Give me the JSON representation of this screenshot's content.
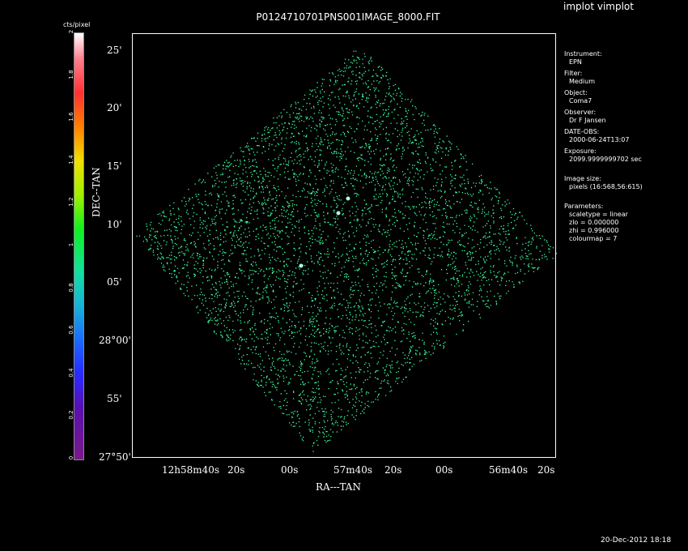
{
  "app_title": "implot vimplot",
  "plot_title": "P0124710701PNS001IMAGE_8000.FIT",
  "colorbar": {
    "label": "cts/pixel",
    "ticks": [
      "0",
      "0.2",
      "0.4",
      "0.6",
      "0.8",
      "1",
      "1.2",
      "1.4",
      "1.6",
      "1.8",
      "2"
    ]
  },
  "axes": {
    "xlabel": "RA---TAN",
    "ylabel": "DEC--TAN",
    "yticks": [
      "25'",
      "20'",
      "15'",
      "10'",
      "05'",
      "28°00'",
      "55'",
      "27°50'"
    ],
    "xticks": [
      "12h58m40s",
      "20s",
      "00s",
      "57m40s",
      "20s",
      "00s",
      "56m40s",
      "20s"
    ]
  },
  "info": {
    "instrument_label": "Instrument:",
    "instrument": "EPN",
    "filter_label": "Filter:",
    "filter": "Medium",
    "object_label": "Object:",
    "object": "Coma7",
    "observer_label": "Observer:",
    "observer": "Dr F Jansen",
    "date_label": "DATE-OBS:",
    "date": "2000-06-24T13:07",
    "exposure_label": "Exposure:",
    "exposure": "2099.9999999702 sec",
    "size_label": "Image size:",
    "size": "pixels (16:568,56:615)",
    "params_label": "Parameters:",
    "param1": "scaletype = linear",
    "param2": "zlo = 0.000000",
    "param3": "zhi = 0.996000",
    "param4": "colourmap =    7"
  },
  "timestamp": "20-Dec-2012 18:18",
  "colors": {
    "background": "#000000",
    "counts": "#3cff9c",
    "frame": "#ffffff"
  }
}
